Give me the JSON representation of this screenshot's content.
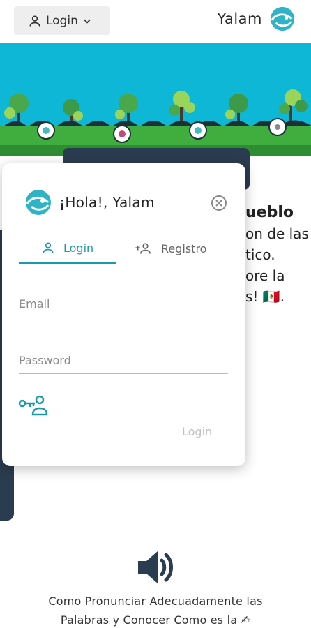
{
  "topbar": {
    "login_menu_label": "Login",
    "brand_name": "Yalam"
  },
  "background": {
    "heading_fragment": "ueblo",
    "line1": "on de las",
    "line2": "tico.",
    "line3": "ore la",
    "line4": "s! 🇲🇽."
  },
  "modal": {
    "title": "¡Hola!, Yalam",
    "tabs": [
      {
        "label": "Login",
        "active": true
      },
      {
        "label": "Registro",
        "active": false
      }
    ],
    "email_placeholder": "Email",
    "password_placeholder": "Password",
    "submit_label": "Login"
  },
  "bottom": {
    "caption_line1": "Como Pronunciar Adecuadamente las",
    "caption_line2": "Palabras y Conocer Como es la ✍"
  },
  "colors": {
    "accent": "#1a9aaa",
    "hero_sky": "#0fb7d6",
    "grass": "#3fae3f",
    "dark": "#2a3c4f"
  }
}
